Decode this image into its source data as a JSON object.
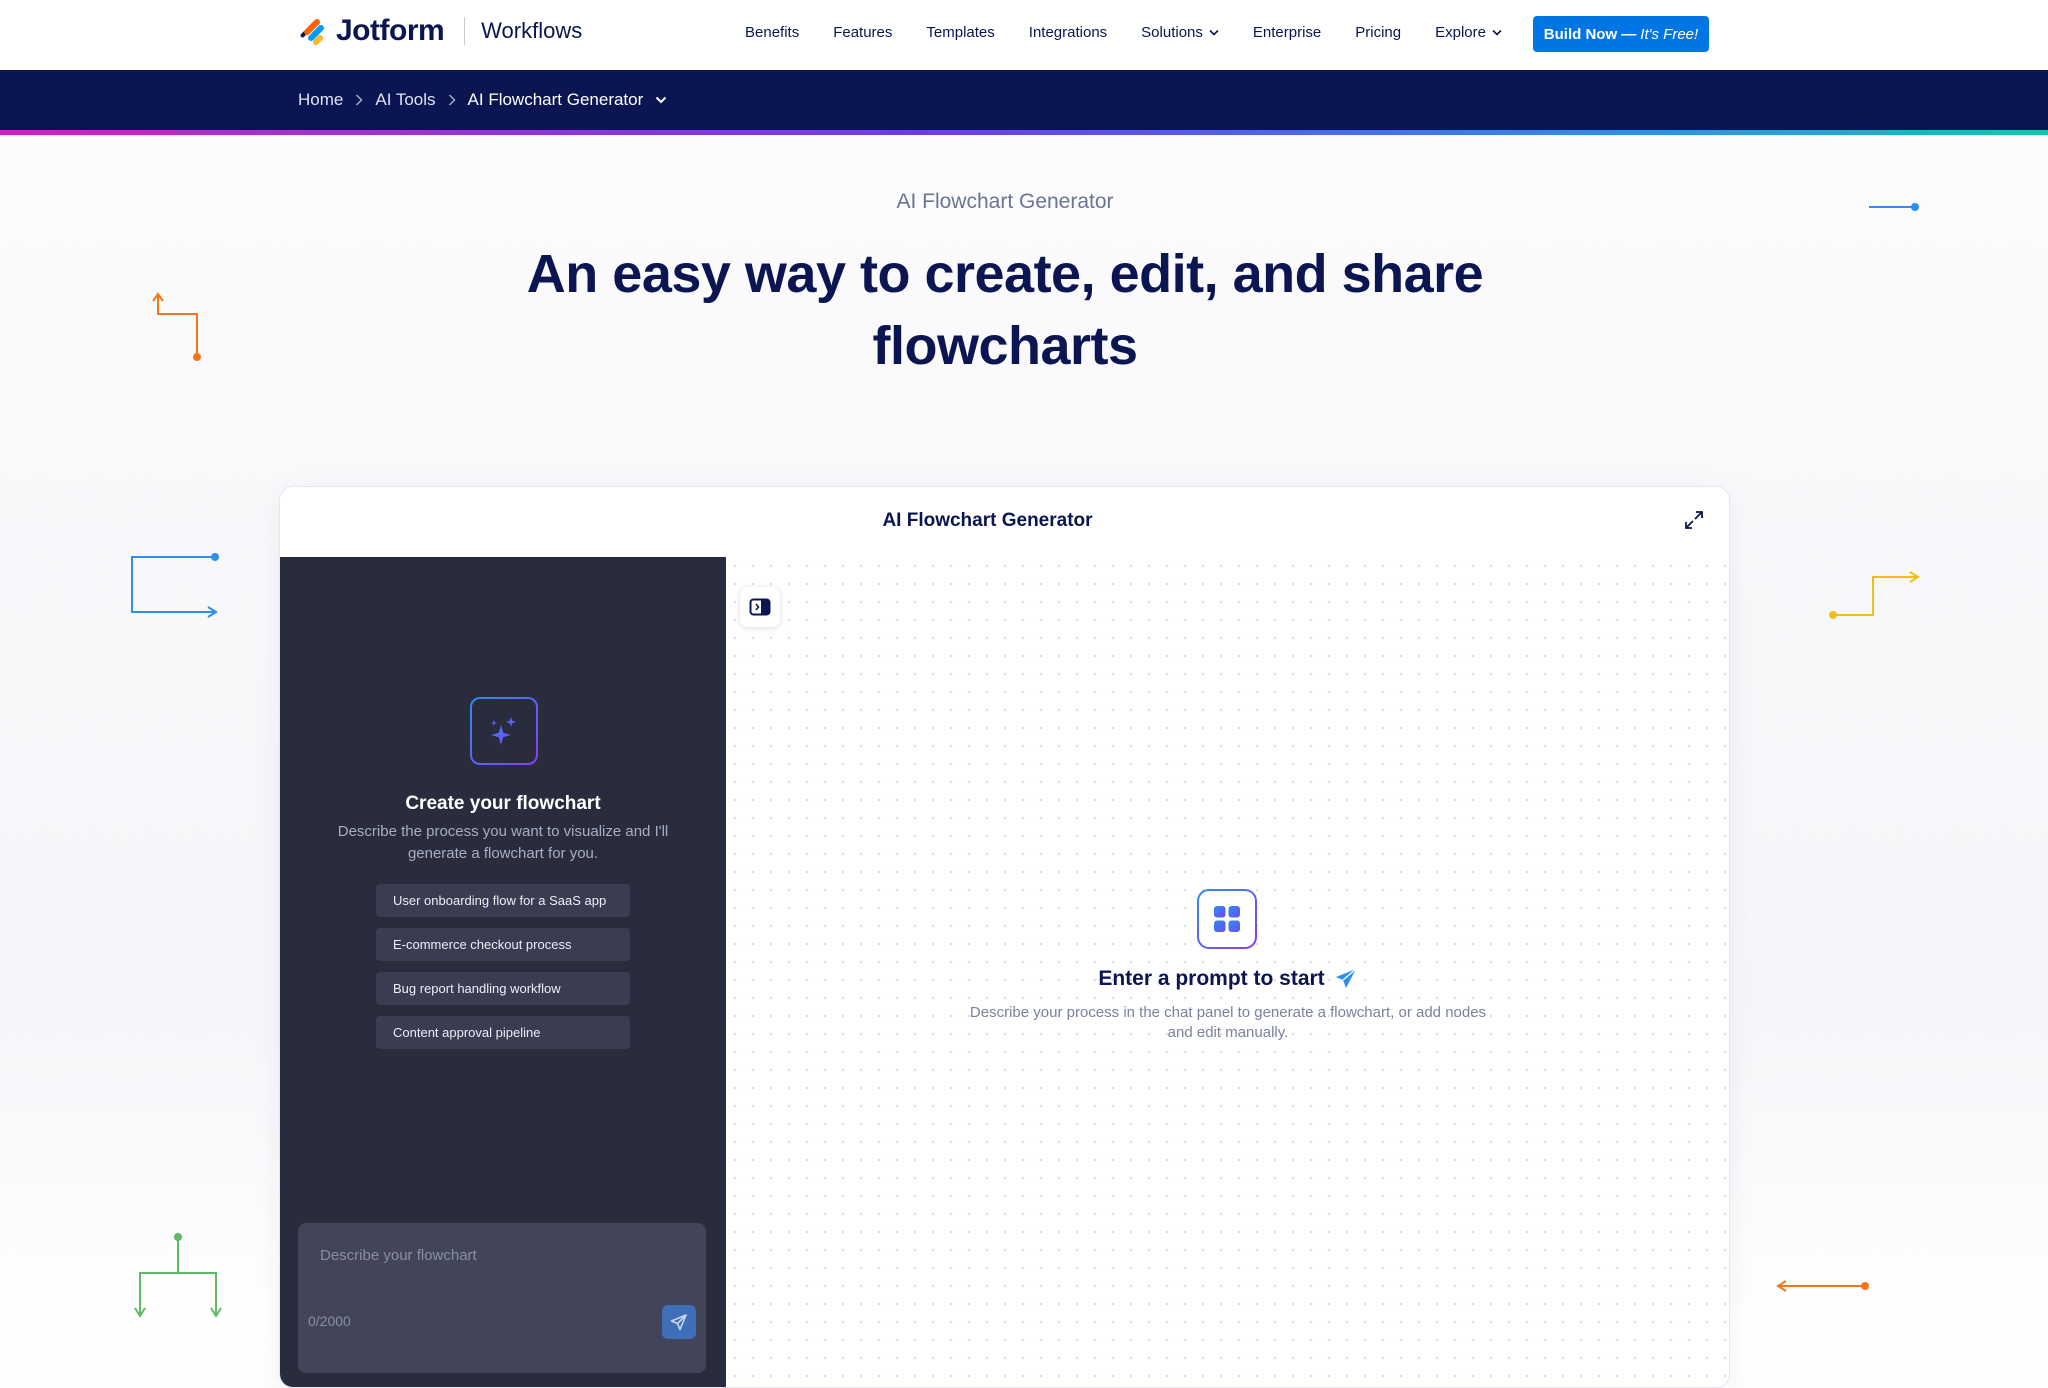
{
  "brand": {
    "name": "Jotform",
    "product": "Workflows"
  },
  "nav": {
    "items": [
      {
        "label": "Benefits",
        "dropdown": false
      },
      {
        "label": "Features",
        "dropdown": false
      },
      {
        "label": "Templates",
        "dropdown": false
      },
      {
        "label": "Integrations",
        "dropdown": false
      },
      {
        "label": "Solutions",
        "dropdown": true
      },
      {
        "label": "Enterprise",
        "dropdown": false
      },
      {
        "label": "Pricing",
        "dropdown": false
      },
      {
        "label": "Explore",
        "dropdown": true
      }
    ],
    "cta": {
      "label": "Build Now —",
      "suffix": "It's Free!"
    }
  },
  "breadcrumb": {
    "home": "Home",
    "section": "AI Tools",
    "current": "AI Flowchart Generator"
  },
  "hero": {
    "eyebrow": "AI Flowchart Generator",
    "title_line1": "An easy way to create, edit, and share",
    "title_line2": "flowcharts"
  },
  "app": {
    "title": "AI Flowchart Generator",
    "chat": {
      "title": "Create your flowchart",
      "subtitle": "Describe the process you want to visualize and I'll generate a flowchart for you.",
      "suggestions": [
        "User onboarding flow for a SaaS app",
        "E-commerce checkout process",
        "Bug report handling workflow",
        "Content approval pipeline"
      ],
      "input_placeholder": "Describe your flowchart",
      "counter": "0/2000"
    },
    "canvas": {
      "title": "Enter a prompt to start",
      "subtitle": "Describe your process in the chat panel to generate a flowchart, or add nodes and edit manually."
    }
  },
  "colors": {
    "navy": "#0a1551",
    "cta_blue": "#0075e3",
    "chat_bg": "#292c3d",
    "accent_orange": "#f5761a",
    "accent_blue": "#2c8ff0",
    "accent_yellow": "#f2bd1c",
    "accent_green": "#5dbb63"
  },
  "icons": [
    "jotform-logo-icon",
    "chevron-right-icon",
    "chevron-down-icon",
    "expand-icon",
    "sparkles-icon",
    "send-icon",
    "panel-toggle-icon",
    "grid-icon",
    "paper-plane-icon"
  ]
}
